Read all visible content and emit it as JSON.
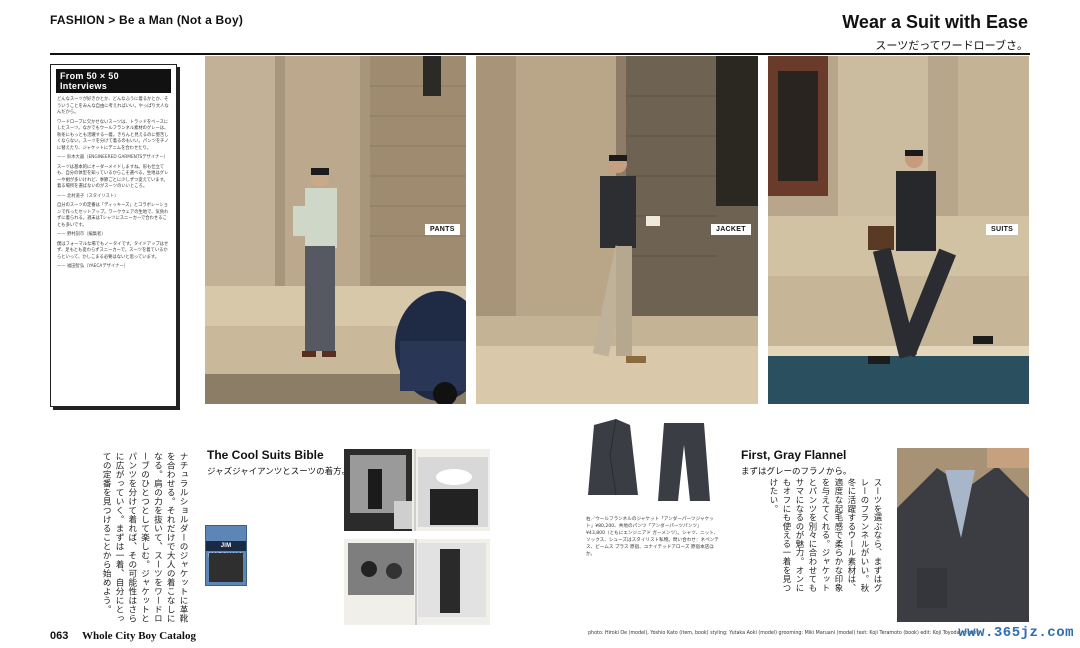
{
  "header": {
    "breadcrumb": "FASHION > Be a Man (Not a Boy)",
    "headline": "Wear a Suit with Ease",
    "headline_jp": "スーツだってワードローブさ。"
  },
  "sidebar": {
    "heading": "From 50 × 50 Interviews",
    "paragraphs": [
      "どんなスーツが好きかとか、どんなふうに着るかとか、そういうことをみんな自由に考えればいい。やっぱり大人なんだから。",
      "ワードローブに欠かせないスーツは、トラッドをベースにしたスーツ。なかでもウールフランネル素材のグレーは、秋冬にもっとも活躍する一着。きちんと見えるのに堅苦しくならない。スーツを分けて着るのもいい。パンツをチノに替えたり、ジャケットにデニムを合わせたり。",
      "—— 鈴木大器（ENGINEERED GARMENTSデザイナー）",
      "スーツは基本的にオーダーメイドしますね。形も仕立ても、自分の体型を知っているからこそ選べる。生地はグレーや紺が多いけれど、季節ごとに少しずつ変えています。着る場所を選ばないのがスーツのいいところ。",
      "—— 北村道子（スタイリスト）",
      "自分のスーツの定番は「ディッキーズ」とコラボレーションで作ったセットアップ。ワークウェアの生地で、気負わずに着られる。週末はTシャツにスニーカーで合わせることも多いです。",
      "—— 野村訓市（編集者）",
      "僕はフォーマルな場でもノータイです。タイドアップはせず、足もとも変わらずスニーカーで。スーツを着ているからといって、かしこまる必要はないと思っています。",
      "—— 福田智弘（YAECAデザイナー）"
    ]
  },
  "photos": {
    "tag_pants": "PANTS",
    "tag_jacket": "JACKET",
    "tag_suits": "SUITS"
  },
  "body_text": "ナチュラルショルダーのジャケットに革靴を合わせる。それだけで大人の着こなしになる。肩の力を抜いて、スーツをワードローブのひとつとして楽しむ。ジャケットとパンツを分けて着れば、その可能性はさらに広がっていく。まずは一着、自分にとっての定番を見つけることから始めよう。",
  "cool_suits": {
    "title": "The Cool Suits Bible",
    "subtitle": "ジャズジャイアンツとスーツの着方。",
    "book_label": "JIM MARSHALL"
  },
  "garment_caption": "右／ウールフランネルのジャケット「アンダーパーツジャケット」¥80,200、共地のパンツ「アンダーパーツパンツ」¥43,800（ともにエンジニアド ガーメンツ）。シャツ、ニット、ソックス、シューズはスタイリスト私物。問い合わせ：ネペンテス、ビームス プラス 原宿、ユナイテッドアローズ 原宿本店ほか。",
  "flannel": {
    "title": "First, Gray Flannel",
    "subtitle": "まずはグレーのフラノから。",
    "body": "スーツを選ぶなら、まずはグレーのフランネルがいい。秋冬に活躍するウール素材は、適度な起毛感で柔らかな印象を与えてくれる。ジャケットとパンツを別々に合わせてもサマになるのが魅力。オンにもオフにも使える一着を見つけたい。"
  },
  "footer": {
    "page_number": "063",
    "magazine": "Whole City Boy Catalog",
    "credits": "photo: Hiroki Oe (model), Yoshio Kato (item, book)   styling: Yutaka Aoki (model)   grooming: Miki Maruani (model)   text: Koji Teramoto (book)   edit: Koji Toyoda (model)",
    "watermark": "www.365jz.com"
  },
  "colors": {
    "ink": "#111111",
    "stone": "#b9a78c",
    "watermark": "#2f6db0"
  }
}
